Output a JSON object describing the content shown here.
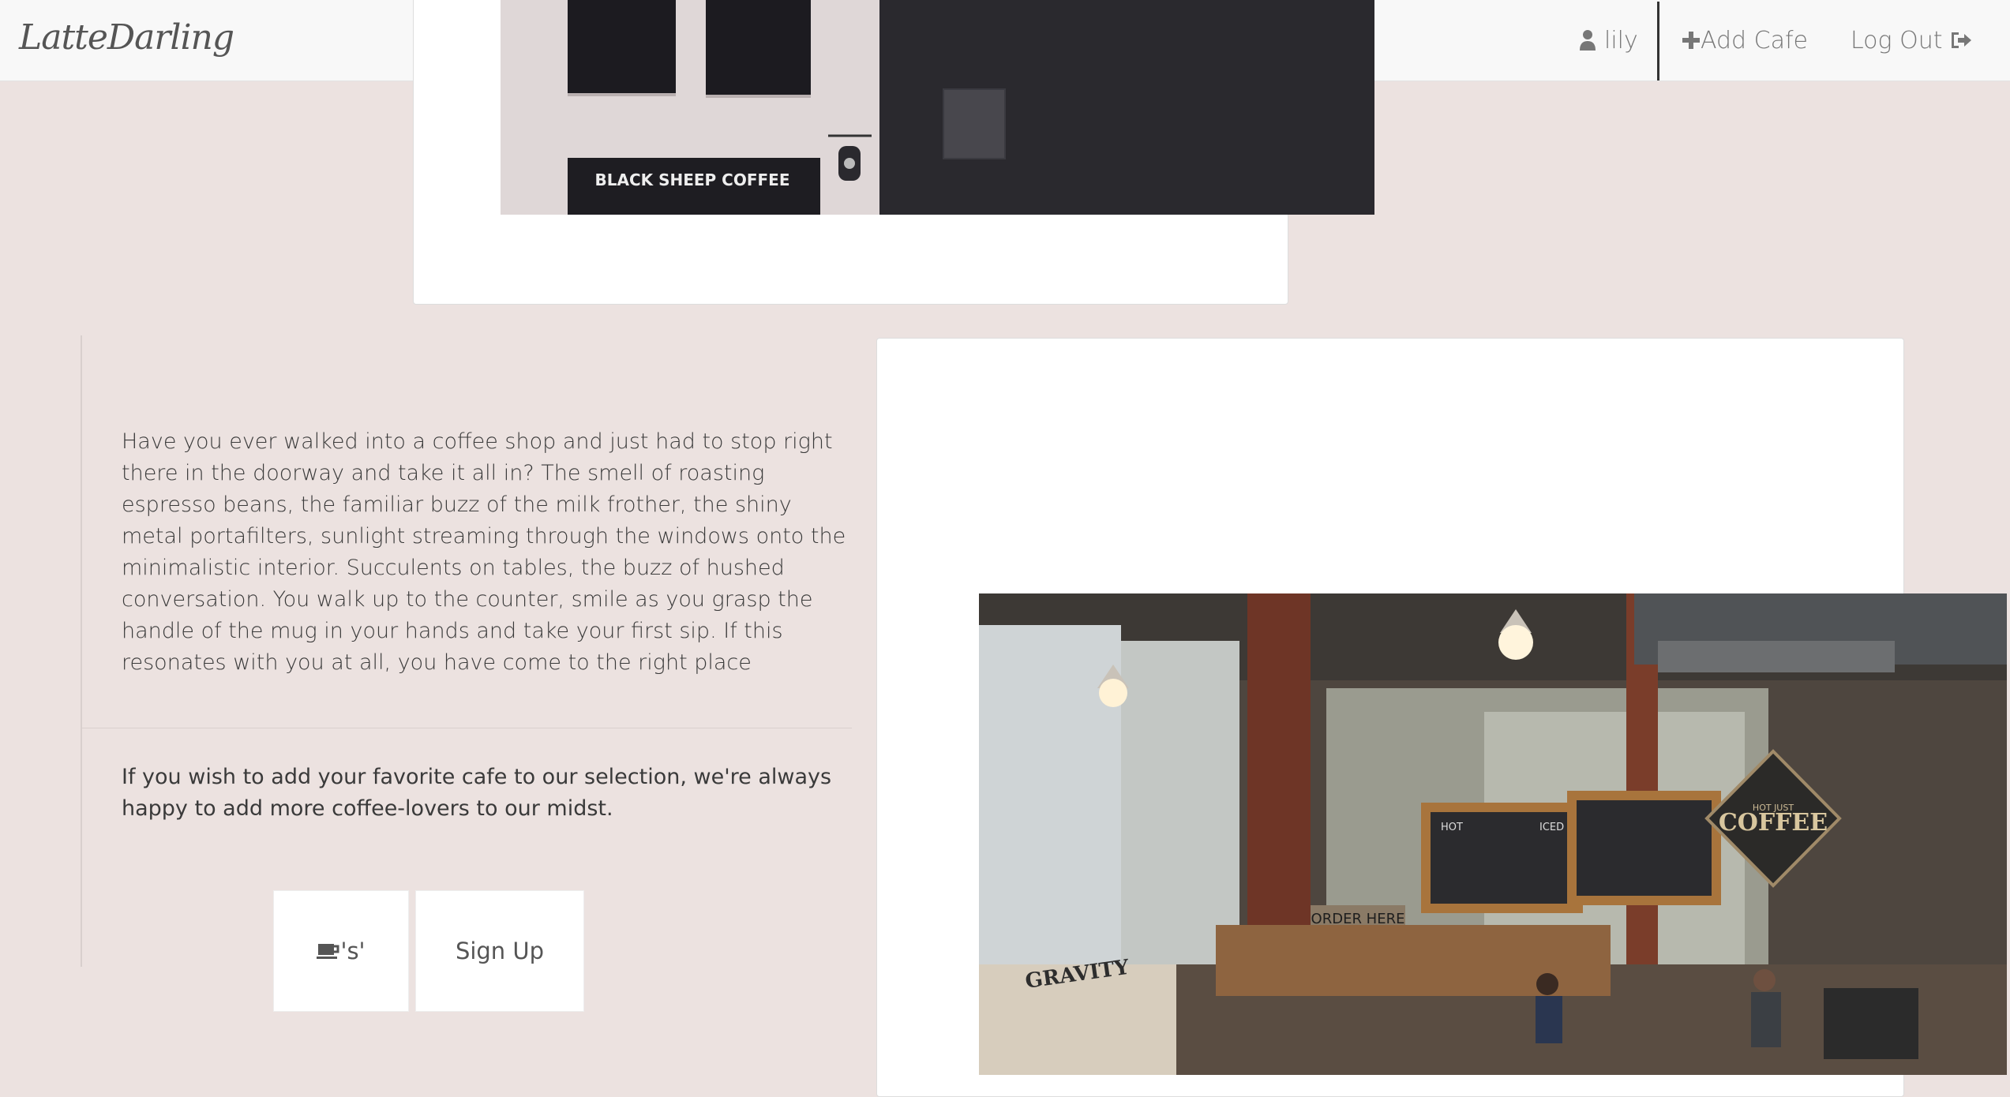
{
  "navbar": {
    "brand": "LatteDarling",
    "user_label": "lily",
    "add_cafe_label": "Add Cafe",
    "logout_label": "Log Out"
  },
  "top_image": {
    "sign_text": "BLACK SHEEP COFFEE"
  },
  "intro": {
    "paragraph": "Have you ever walked into a coffee shop and just had to stop right there in the doorway and take it all in? The smell of roasting espresso beans, the familiar buzz of the milk frother, the shiny metal portafilters, sunlight streaming through the windows onto the minimalistic interior. Succulents on tables, the buzz of hushed conversation. You walk up to the counter, smile as you grasp the handle of the mug in your hands and take your first sip. If this resonates with you at all, you have come to the right place",
    "add_note": "If you wish to add your favorite cafe to our selection, we're always happy to add more coffee-lovers to our midst."
  },
  "buttons": {
    "cafes_suffix": "'s'",
    "signup_label": "Sign Up"
  },
  "cafe_image": {
    "coffee_sign": "COFFEE",
    "sign_top": "HOT JUST",
    "order_here": "ORDER HERE",
    "menu_left_title": "HOT",
    "menu_left_right": "ICED",
    "gravity_box": "GRAVITY"
  },
  "colors": {
    "page_bg": "#ece2e0",
    "navbar_bg": "#f8f8f8",
    "card_bg": "#ffffff"
  }
}
